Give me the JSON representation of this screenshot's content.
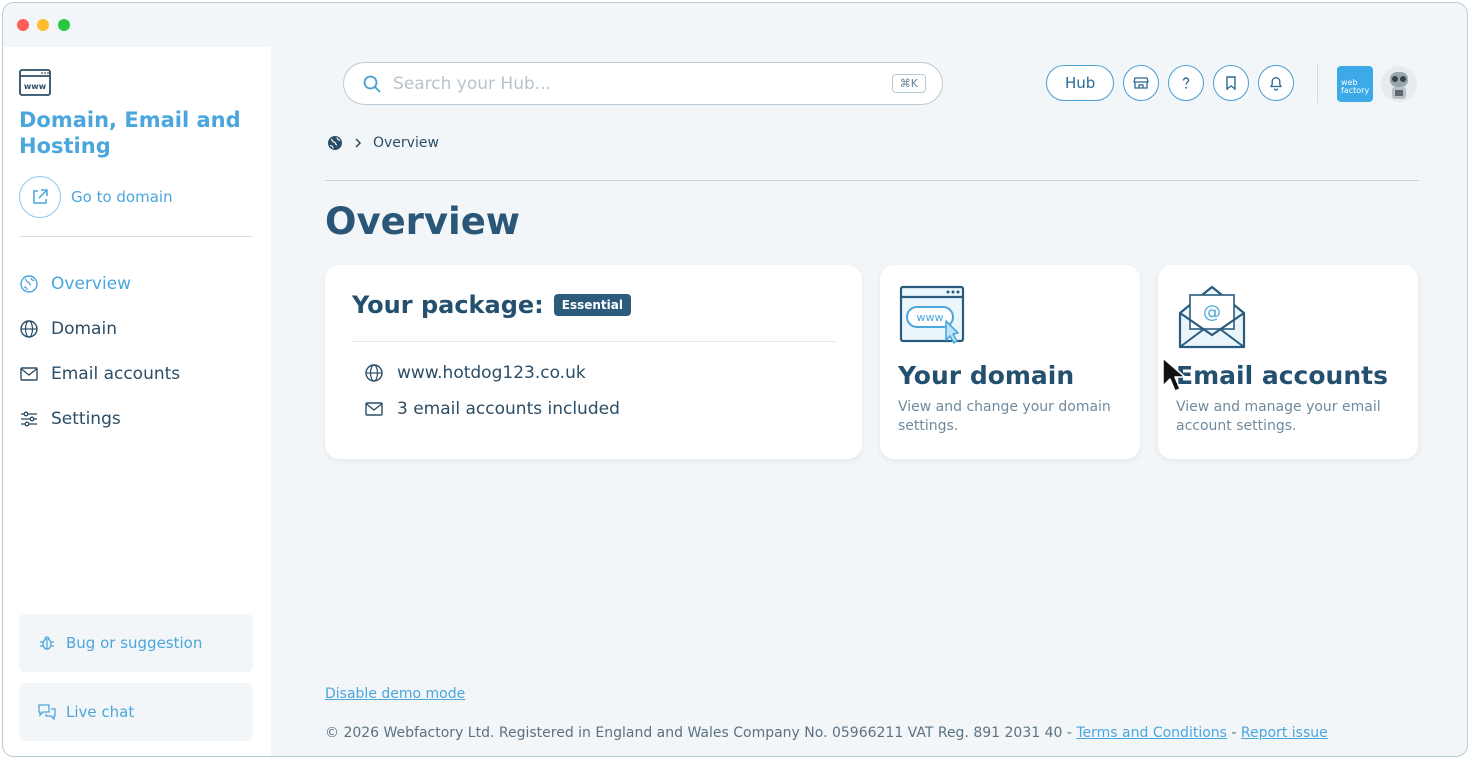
{
  "window": {
    "traffic_lights": [
      "close",
      "minimize",
      "maximize"
    ]
  },
  "sidebar": {
    "title": "Domain, Email and Hosting",
    "logo_icon": "www-browser-icon",
    "go_to_domain": "Go to domain",
    "nav": [
      {
        "label": "Overview",
        "icon": "globe-filled-icon",
        "active": true
      },
      {
        "label": "Domain",
        "icon": "globe-icon",
        "active": false
      },
      {
        "label": "Email accounts",
        "icon": "envelope-icon",
        "active": false
      },
      {
        "label": "Settings",
        "icon": "sliders-icon",
        "active": false
      }
    ],
    "bug_button": "Bug or suggestion",
    "chat_button": "Live chat"
  },
  "header": {
    "search_placeholder": "Search your Hub...",
    "search_shortcut": "⌘K",
    "hub_button": "Hub",
    "icons": [
      "store-icon",
      "help-icon",
      "bookmark-icon",
      "bell-icon"
    ],
    "brand_logo_text": "web factory"
  },
  "breadcrumb": {
    "current": "Overview"
  },
  "page": {
    "title": "Overview"
  },
  "package_card": {
    "title": "Your package:",
    "badge": "Essential",
    "domain": "www.hotdog123.co.uk",
    "emails": "3 email accounts included"
  },
  "feature_cards": [
    {
      "title": "Your domain",
      "description": "View and change your domain settings.",
      "illustration": "www-browser-illustration"
    },
    {
      "title": "Email accounts",
      "description": "View and manage your email account settings.",
      "illustration": "envelope-at-illustration"
    }
  ],
  "footer": {
    "demo_link": "Disable demo mode",
    "copyright": "© 2026 Webfactory Ltd. Registered in England and Wales Company No. 05966211 VAT Reg. 891 2031 40 - ",
    "terms": "Terms and Conditions",
    "separator": " - ",
    "report": "Report issue"
  },
  "colors": {
    "accent": "#4aa6dc",
    "heading": "#24506f",
    "badge": "#2c5b7c",
    "background": "#f3f6f8"
  }
}
